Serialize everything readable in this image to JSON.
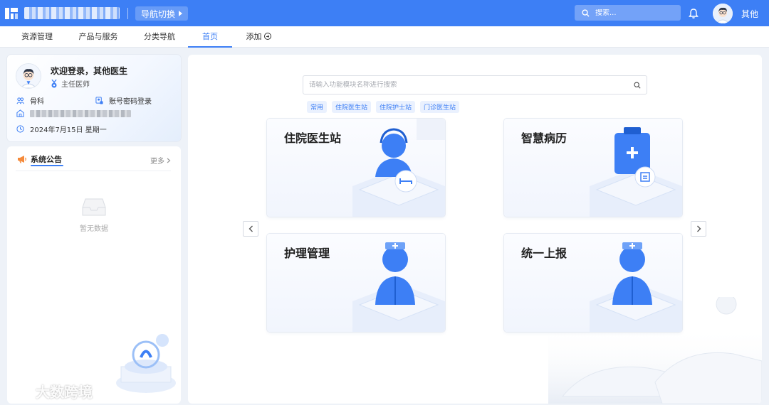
{
  "topbar": {
    "nav_switch_label": "导航切换",
    "search_placeholder": "搜索...",
    "user_name": "其他"
  },
  "tabs": [
    {
      "label": "资源管理",
      "active": false
    },
    {
      "label": "产品与服务",
      "active": false
    },
    {
      "label": "分类导航",
      "active": false
    },
    {
      "label": "首页",
      "active": true
    },
    {
      "label": "添加",
      "active": false
    }
  ],
  "user_card": {
    "welcome": "欢迎登录，其他医生",
    "title": "主任医师",
    "department": "骨科",
    "login_method": "账号密码登录",
    "date": "2024年7月15日 星期一"
  },
  "notice": {
    "title": "系统公告",
    "more": "更多",
    "empty": "暂无数据"
  },
  "main": {
    "search_placeholder": "请输入功能模块名称进行搜索",
    "quick_tags": [
      "常用",
      "住院医生站",
      "住院护士站",
      "门诊医生站"
    ],
    "modules": [
      "住院医生站",
      "智慧病历",
      "护理管理",
      "统一上报"
    ]
  },
  "watermark": "大数跨境",
  "colors": {
    "primary": "#3d7ff5",
    "background": "#eef2f8"
  }
}
